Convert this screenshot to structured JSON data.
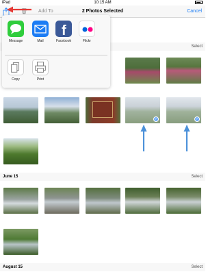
{
  "status": {
    "carrier": "iPad",
    "time": "10:15 AM"
  },
  "navbar": {
    "add_to": "Add To",
    "title": "2 Photos Selected",
    "cancel": "Cancel"
  },
  "sections": [
    {
      "title": "",
      "select": "Select"
    },
    {
      "title": "June 15",
      "select": "Select"
    },
    {
      "title": "August 15",
      "select": "Select"
    }
  ],
  "share_sheet": {
    "apps": [
      {
        "label": "Message",
        "icon": "message-icon",
        "color": "#2fcd3c"
      },
      {
        "label": "Mail",
        "icon": "mail-icon",
        "color": "#1c7cf4"
      },
      {
        "label": "Facebook",
        "icon": "facebook-icon",
        "color": "#3b5998"
      },
      {
        "label": "Flickr",
        "icon": "flickr-icon",
        "color": "#ffffff"
      }
    ],
    "actions": [
      {
        "label": "Copy",
        "icon": "copy-icon"
      },
      {
        "label": "Print",
        "icon": "print-icon"
      }
    ]
  },
  "colors": {
    "accent": "#1a7cf5",
    "annotation_red": "#e53935",
    "annotation_blue": "#4a90d9"
  },
  "photos_section1": [
    {
      "desc": "mountain-ridge",
      "selected": false
    },
    {
      "desc": "rhododendron-bush",
      "selected": false
    },
    {
      "desc": "rhododendron-bush",
      "selected": false
    },
    {
      "desc": "rhododendron-bush",
      "selected": false
    },
    {
      "desc": "mountain-valley",
      "selected": false
    },
    {
      "desc": "cloudy-mountains",
      "selected": false
    },
    {
      "desc": "wooden-sign",
      "selected": false
    },
    {
      "desc": "mountain-vista",
      "selected": true
    },
    {
      "desc": "mountain-vista",
      "selected": true
    },
    {
      "desc": "green-meadow",
      "selected": false
    }
  ],
  "photos_section2": [
    {
      "desc": "waterfall-rocks",
      "selected": false
    },
    {
      "desc": "creek-rocks",
      "selected": false
    },
    {
      "desc": "creek-rocks",
      "selected": false
    },
    {
      "desc": "waterfall-pool",
      "selected": false
    },
    {
      "desc": "waterfall-pool",
      "selected": false
    },
    {
      "desc": "forest-creek",
      "selected": false
    }
  ]
}
